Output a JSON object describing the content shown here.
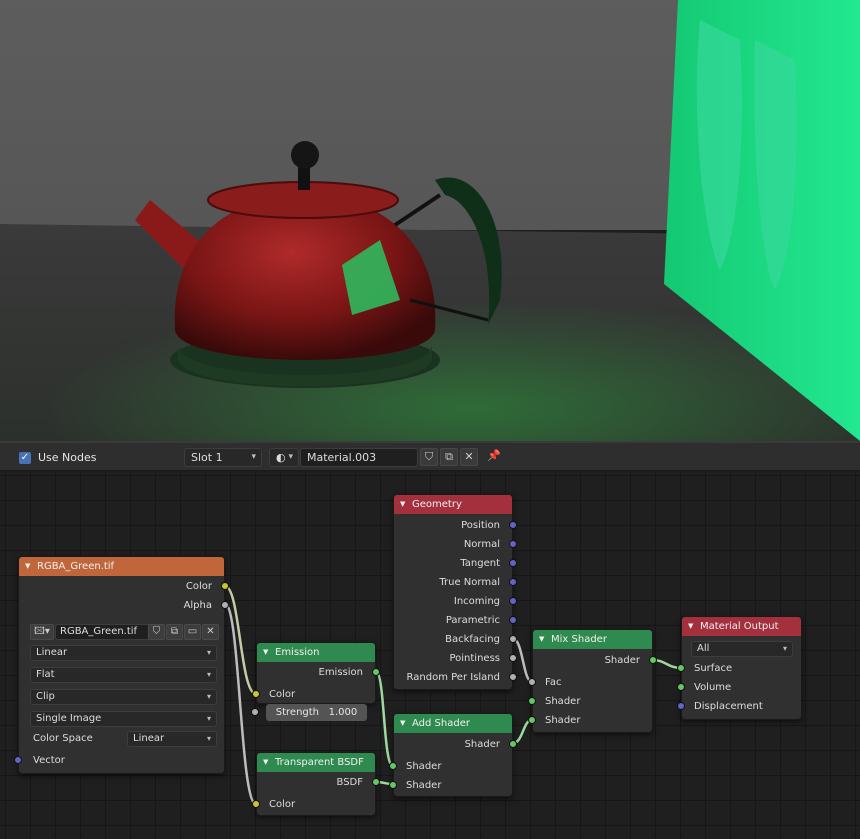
{
  "header": {
    "use_nodes_label": "Use Nodes",
    "use_nodes_checked": true,
    "slot": "Slot 1",
    "material_name": "Material.003"
  },
  "nodes": {
    "image_texture": {
      "title": "RGBA_Green.tif",
      "outputs": [
        "Color",
        "Alpha"
      ],
      "image_name": "RGBA_Green.tif",
      "interpolation": "Linear",
      "projection": "Flat",
      "extension": "Clip",
      "source": "Single Image",
      "color_space_label": "Color Space",
      "color_space": "Linear",
      "vector_label": "Vector"
    },
    "emission": {
      "title": "Emission",
      "output": "Emission",
      "color_label": "Color",
      "strength_label": "Strength",
      "strength_value": "1.000"
    },
    "transparent": {
      "title": "Transparent BSDF",
      "output": "BSDF",
      "color_label": "Color"
    },
    "geometry": {
      "title": "Geometry",
      "outputs": [
        "Position",
        "Normal",
        "Tangent",
        "True Normal",
        "Incoming",
        "Parametric",
        "Backfacing",
        "Pointiness",
        "Random Per Island"
      ]
    },
    "add_shader": {
      "title": "Add Shader",
      "output": "Shader",
      "inputs": [
        "Shader",
        "Shader"
      ]
    },
    "mix_shader": {
      "title": "Mix Shader",
      "output": "Shader",
      "inputs": [
        "Fac",
        "Shader",
        "Shader"
      ]
    },
    "material_output": {
      "title": "Material Output",
      "target": "All",
      "inputs": [
        "Surface",
        "Volume",
        "Displacement"
      ]
    }
  },
  "colors": {
    "texture_header": "#c0663a",
    "input_header": "#a4303e",
    "shader_header": "#2f8a4f",
    "socket_color": "#c7c729",
    "socket_float": "#b0b0b0",
    "socket_vector": "#6363c7",
    "socket_shader": "#63c763",
    "accent": "#4772b3"
  }
}
